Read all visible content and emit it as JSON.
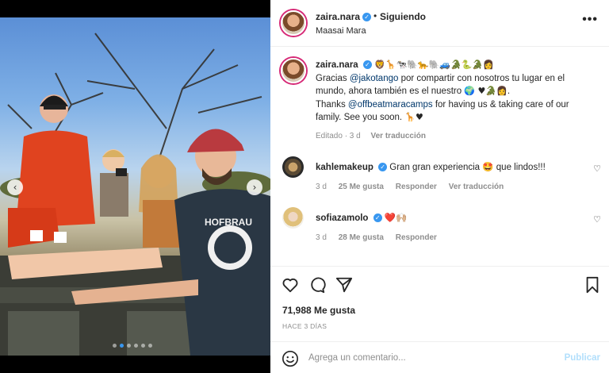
{
  "post": {
    "username": "zaira.nara",
    "follow_status": "Siguiendo",
    "separator": "•",
    "location": "Maasai Mara",
    "more": "•••"
  },
  "caption": {
    "username": "zaira.nara",
    "header_emojis": "🦁🦒🐄🐘🐆🐘🚙🐊🐍🐊👩",
    "line1_pre": "Gracias ",
    "mention1": "@jakotango",
    "line1_post": " por compartir con nosotros tu lugar en el mundo, ahora también es el nuestro ",
    "line1_emojis": "🌍 ♥🐊👩.",
    "line2_pre": "Thanks ",
    "mention2": "@offbeatmaracamps",
    "line2_post": " for having us & taking care of our family. See you soon. ",
    "line2_emojis": "🦒♥",
    "edited": "Editado · 3 d",
    "see_translation": "Ver traducción"
  },
  "comments": [
    {
      "username": "kahlemakeup",
      "text": "Gran gran experiencia 🤩 que lindos!!!",
      "age": "3 d",
      "likes": "25 Me gusta",
      "reply": "Responder",
      "translate": "Ver traducción"
    },
    {
      "username": "sofiazamolo",
      "text": "❤️🙌🏼",
      "age": "3 d",
      "likes": "28 Me gusta",
      "reply": "Responder"
    }
  ],
  "stats": {
    "likes": "71,988 Me gusta",
    "time_ago": "HACE 3 DÍAS"
  },
  "comment_box": {
    "placeholder": "Agrega un comentario...",
    "publish": "Publicar"
  },
  "carousel": {
    "prev": "‹",
    "next": "›",
    "current": 2,
    "count": 6
  },
  "colors": {
    "verified": "#3897f0",
    "mention": "#00376b",
    "publish_disabled": "#b2dffc"
  }
}
